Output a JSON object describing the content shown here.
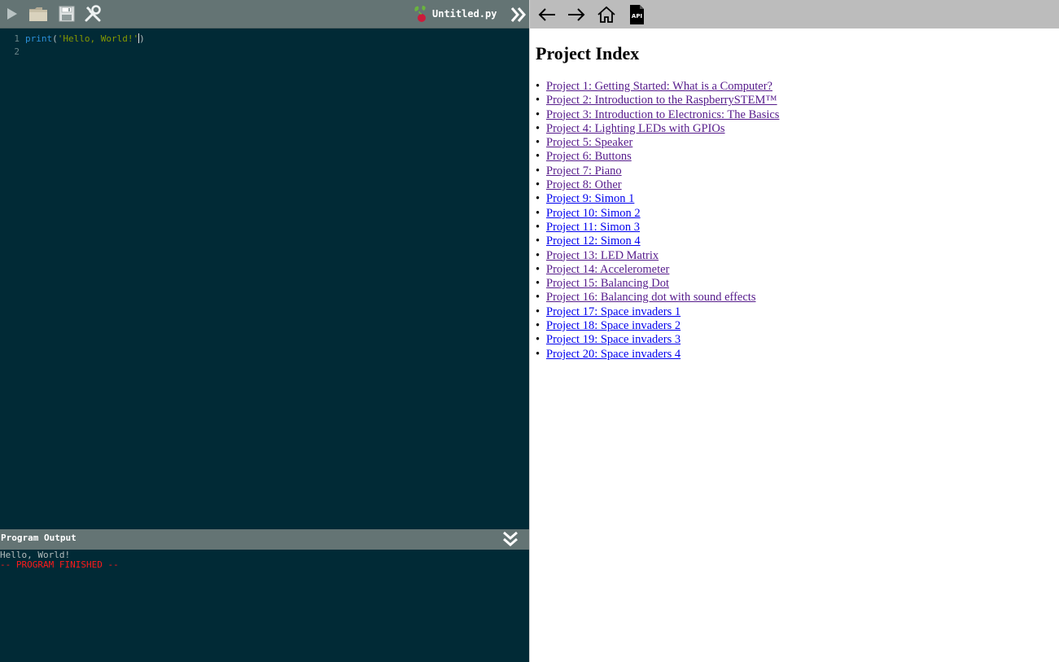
{
  "editor": {
    "toolbar": {
      "buttons": [
        {
          "name": "run",
          "icon": "play-icon"
        },
        {
          "name": "open",
          "icon": "folder-icon"
        },
        {
          "name": "save",
          "icon": "floppy-disk-icon"
        },
        {
          "name": "settings",
          "icon": "tools-icon"
        }
      ],
      "file_name": "Untitled.py",
      "file_icon": "raspberry-pi-icon",
      "collapse_icon": "double-chevron-right-icon"
    },
    "code_lines": [
      {
        "number": "1",
        "fn": "print",
        "open": "(",
        "str": "'Hello, World!'",
        "close": ")"
      },
      {
        "number": "2"
      }
    ],
    "output": {
      "title": "Program Output",
      "collapse_icon": "double-chevron-down-icon",
      "lines": [
        {
          "text": "Hello, World!",
          "kind": "normal"
        },
        {
          "text": "-- PROGRAM FINISHED --",
          "kind": "finished"
        }
      ]
    }
  },
  "browser": {
    "nav": {
      "back_icon": "arrow-left-icon",
      "forward_icon": "arrow-right-icon",
      "home_icon": "home-icon",
      "api_icon": "api-document-icon",
      "api_label": "API"
    },
    "title": "Project Index",
    "projects": [
      {
        "label": "Project 1: Getting Started: What is a Computer?",
        "visited": true
      },
      {
        "label": "Project 2: Introduction to the RaspberrySTEM™",
        "visited": true
      },
      {
        "label": "Project 3: Introduction to Electronics: The Basics",
        "visited": true
      },
      {
        "label": "Project 4: Lighting LEDs with GPIOs",
        "visited": true
      },
      {
        "label": "Project 5: Speaker",
        "visited": true
      },
      {
        "label": "Project 6: Buttons",
        "visited": true
      },
      {
        "label": "Project 7: Piano",
        "visited": true
      },
      {
        "label": "Project 8: Other",
        "visited": true
      },
      {
        "label": "Project 9: Simon 1",
        "visited": false
      },
      {
        "label": "Project 10: Simon 2",
        "visited": false
      },
      {
        "label": "Project 11: Simon 3",
        "visited": false
      },
      {
        "label": "Project 12: Simon 4",
        "visited": false
      },
      {
        "label": "Project 13: LED Matrix",
        "visited": true
      },
      {
        "label": "Project 14: Accelerometer",
        "visited": true
      },
      {
        "label": "Project 15: Balancing Dot",
        "visited": true
      },
      {
        "label": "Project 16: Balancing dot with sound effects",
        "visited": true
      },
      {
        "label": "Project 17: Space invaders 1",
        "visited": false
      },
      {
        "label": "Project 18: Space invaders 2",
        "visited": false
      },
      {
        "label": "Project 19: Space invaders 3",
        "visited": false
      },
      {
        "label": "Project 20: Space invaders 4",
        "visited": false
      }
    ]
  },
  "colors": {
    "editor_bg": "#012a36",
    "toolbar_bg": "#647474",
    "browser_toolbar_bg": "#bcbcbc",
    "string": "#859900",
    "function": "#2b90d9",
    "finished": "#ff1a1a",
    "link_visited": "#551a8b",
    "link_unvisited": "#0000ee"
  }
}
